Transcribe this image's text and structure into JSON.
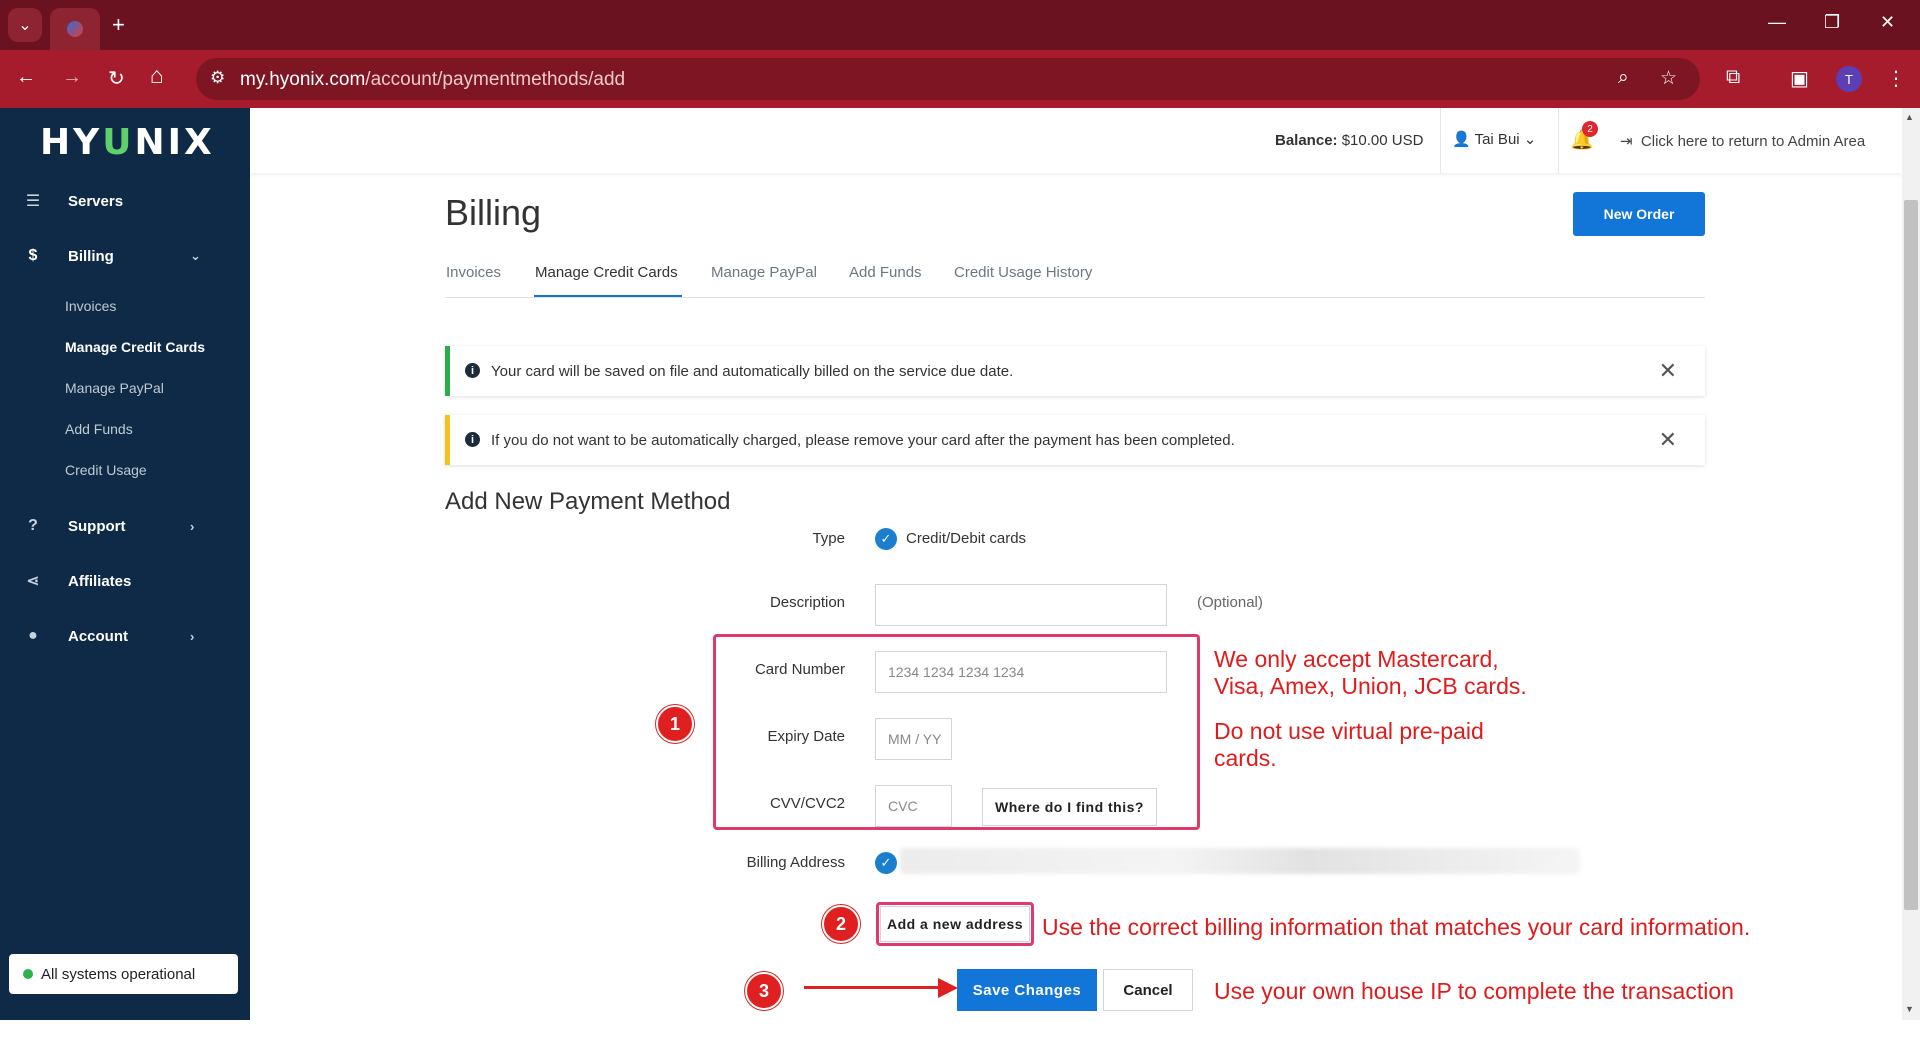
{
  "browser": {
    "url_host": "my.hyonix.com",
    "url_path": "/account/paymentmethods/add",
    "profile_initial": "T",
    "new_tab": "+",
    "minimize": "—",
    "maximize": "❐",
    "close": "✕",
    "back": "←",
    "forward": "→",
    "reload": "↻",
    "home": "⌂"
  },
  "sidebar": {
    "brand_pre": "HY",
    "brand_leaf": "U",
    "brand_post": "NIX",
    "items": [
      {
        "label": "Servers",
        "icon": "servers-icon"
      },
      {
        "label": "Billing",
        "icon": "dollar-icon"
      },
      {
        "label": "Support",
        "icon": "help-icon"
      },
      {
        "label": "Affiliates",
        "icon": "share-icon"
      },
      {
        "label": "Account",
        "icon": "user-icon"
      }
    ],
    "billing_sub": [
      "Invoices",
      "Manage Credit Cards",
      "Manage PayPal",
      "Add Funds",
      "Credit Usage"
    ],
    "status": "All systems operational"
  },
  "header": {
    "balance_label": "Balance:",
    "balance_value": "$10.00 USD",
    "user_name": "Tai Bui",
    "notification_count": "2",
    "admin_link": "Click here to return to Admin Area"
  },
  "page": {
    "title": "Billing",
    "new_order": "New Order",
    "tabs": [
      "Invoices",
      "Manage Credit Cards",
      "Manage PayPal",
      "Add Funds",
      "Credit Usage History"
    ],
    "alert_green": "Your card will be saved on file and automatically billed on the service due date.",
    "alert_yellow": "If you do not want to be automatically charged, please remove your card after the payment has been completed.",
    "section_title": "Add New Payment Method",
    "form": {
      "type_label": "Type",
      "type_value": "Credit/Debit cards",
      "description_label": "Description",
      "description_optional": "(Optional)",
      "card_number_label": "Card Number",
      "card_number_placeholder": "1234 1234 1234 1234",
      "expiry_label": "Expiry Date",
      "expiry_placeholder": "MM / YY",
      "cvv_label": "CVV/CVC2",
      "cvv_placeholder": "CVC",
      "where_find": "Where do I find this?",
      "billing_address_label": "Billing Address",
      "add_address": "Add a new address",
      "save": "Save Changes",
      "cancel": "Cancel"
    }
  },
  "annotations": {
    "n1": "1",
    "n2": "2",
    "n3": "3",
    "note1a": "We only accept Mastercard,",
    "note1b": "Visa, Amex, Union, JCB cards.",
    "note1c": "Do not use virtual pre-paid",
    "note1d": "cards.",
    "note2": "Use the correct billing information that matches your card information.",
    "note3": "Use your own house IP to complete the transaction"
  },
  "colors": {
    "chrome_top": "#6b1220",
    "chrome_toolbar": "#a61c2c",
    "sidebar_bg": "#0e2a47",
    "primary_button": "#1275d8",
    "annotation_red": "#e01b1b"
  }
}
